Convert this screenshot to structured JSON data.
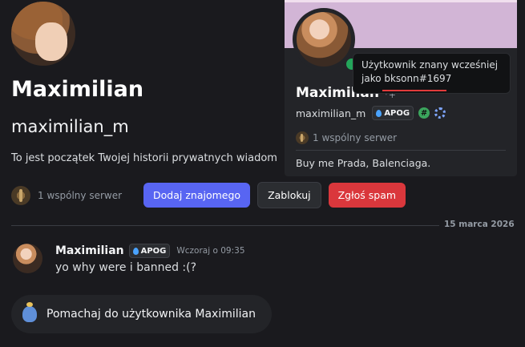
{
  "profile": {
    "display_name": "Maximilian",
    "username": "maximilian_m",
    "intro_text": "To jest początek Twojej historii prywatnych wiadom"
  },
  "actions": {
    "mutual_servers": "1 wspólny serwer",
    "add_friend": "Dodaj znajomego",
    "block": "Zablokuj",
    "report_spam": "Zgłoś spam"
  },
  "divider": {
    "date": "15 marca 2026"
  },
  "message": {
    "author": "Maximilian",
    "tag": "APOG",
    "timestamp": "Wczoraj o 09:35",
    "text": "yo why were i banned :(?"
  },
  "wave_prompt": {
    "label": "Pomachaj do użytkownika Maximilian"
  },
  "popout": {
    "name": "Maximilian",
    "plus_glyph": "⁺+",
    "username": "maximilian_m",
    "tag": "APOG",
    "hash_badge": "#",
    "mutual_servers": "1 wspólny serwer",
    "bio": "Buy me Prada, Balenciaga.",
    "banner_color": "#d2b5d6",
    "status_color": "#23a55a"
  },
  "tooltip": {
    "line1": "Użytkownik znany wcześniej",
    "line2": "jako bksonn#1697"
  },
  "colors": {
    "background": "#1a1a1e",
    "primary": "#5865f2",
    "danger": "#da373c"
  }
}
